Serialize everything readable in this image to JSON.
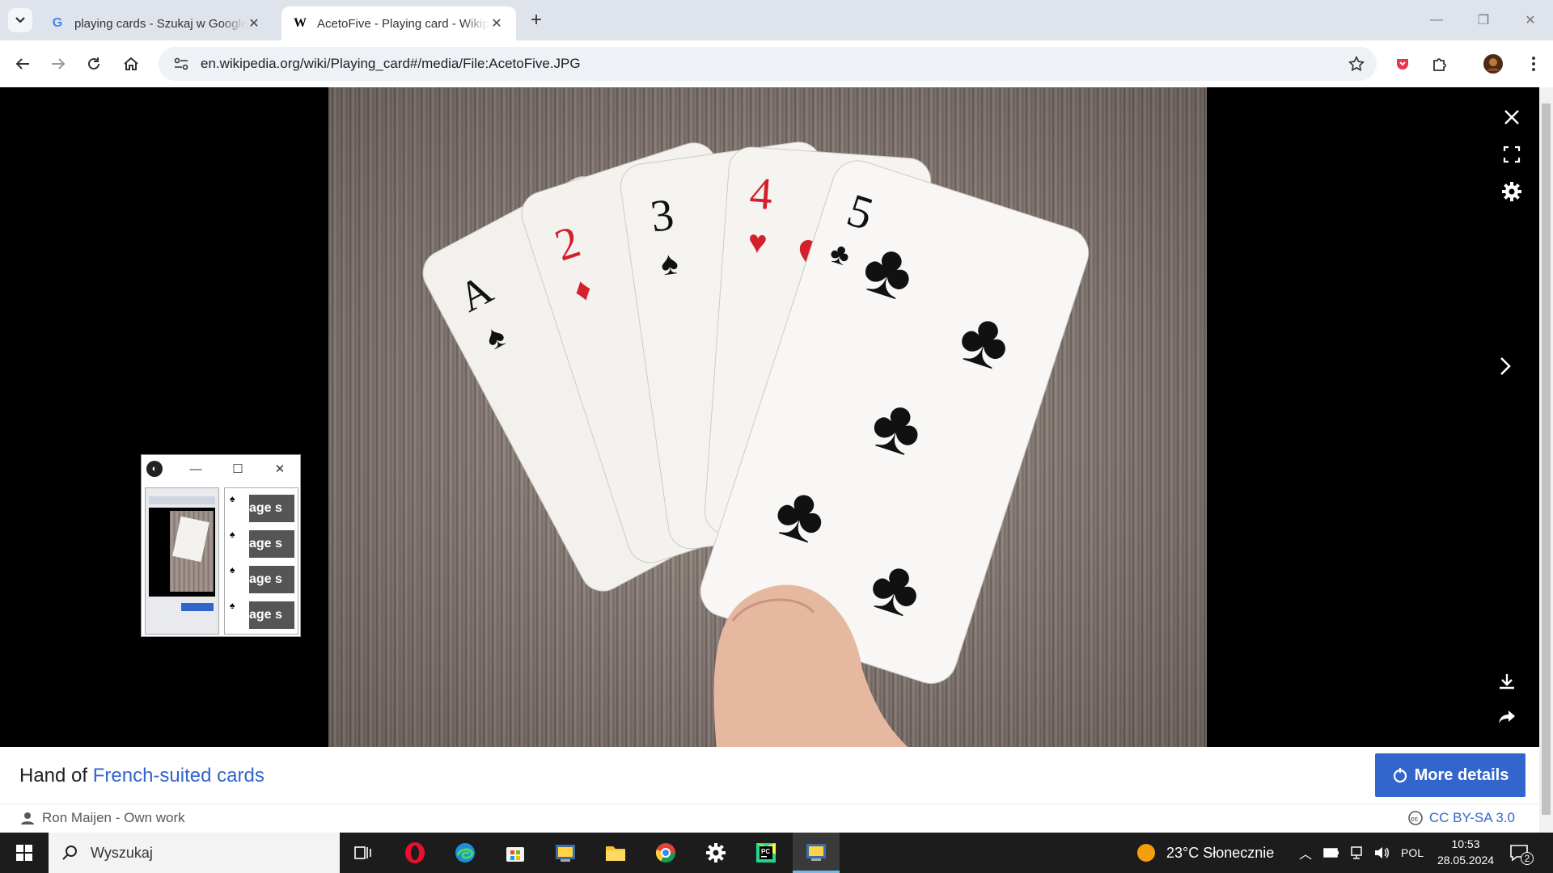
{
  "browser": {
    "tabs": [
      {
        "title": "playing cards - Szukaj w Google",
        "favicon": "G",
        "active": false
      },
      {
        "title": "AcetoFive - Playing card - Wikipedia",
        "favicon": "W",
        "active": true
      }
    ],
    "url": "en.wikipedia.org/wiki/Playing_card#/media/File:AcetoFive.JPG"
  },
  "media": {
    "card_ranks": [
      "A",
      "2",
      "3",
      "4",
      "5"
    ],
    "mini_window": {
      "overlay_text": [
        "age s",
        "age s",
        "age s",
        "age s"
      ]
    }
  },
  "caption": {
    "prefix": "Hand of ",
    "link": "French-suited cards",
    "author": "Ron Maijen - Own work",
    "license": "CC BY-SA 3.0",
    "more_details": "More details"
  },
  "taskbar": {
    "search_placeholder": "Wyszukaj",
    "weather": "23°C  Słonecznie",
    "language": "POL",
    "time": "10:53",
    "date": "28.05.2024",
    "notifications": "2"
  },
  "colors": {
    "link": "#3366cc",
    "button": "#3366cc",
    "red_suit": "#d4202a"
  }
}
